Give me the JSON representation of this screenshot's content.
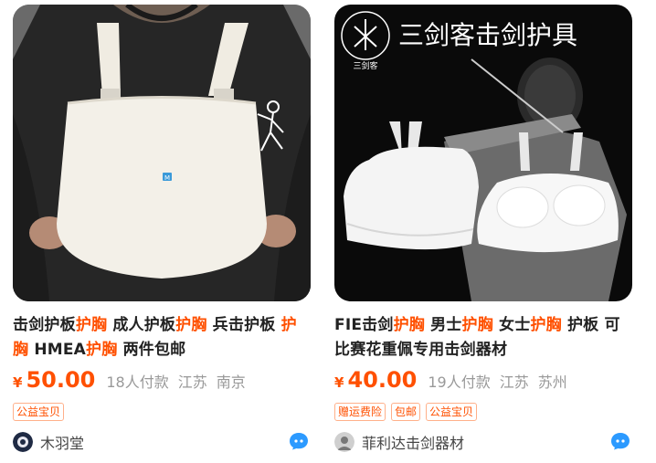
{
  "products": [
    {
      "title_parts": [
        {
          "text": "击剑护板",
          "hl": false
        },
        {
          "text": "护胸",
          "hl": true
        },
        {
          "text": " 成人护板",
          "hl": false
        },
        {
          "text": "护胸",
          "hl": true
        },
        {
          "text": " 兵击护板 ",
          "hl": false
        },
        {
          "text": "护胸",
          "hl": true
        },
        {
          "text": " HMEA",
          "hl": false
        },
        {
          "text": "护胸",
          "hl": true
        },
        {
          "text": " 两件包邮",
          "hl": false
        }
      ],
      "currency": "¥",
      "price": "50.00",
      "sold": "18人付款",
      "province": "江苏",
      "city": "南京",
      "tags": [
        "公益宝贝"
      ],
      "shop_name": "木羽堂",
      "image_tag": "M"
    },
    {
      "title_parts": [
        {
          "text": "FIE击剑",
          "hl": false
        },
        {
          "text": "护胸",
          "hl": true
        },
        {
          "text": " 男士",
          "hl": false
        },
        {
          "text": "护胸",
          "hl": true
        },
        {
          "text": " 女士",
          "hl": false
        },
        {
          "text": "护胸",
          "hl": true
        },
        {
          "text": " 护板 可比赛花重佩专用击剑器材",
          "hl": false
        }
      ],
      "currency": "¥",
      "price": "40.00",
      "sold": "19人付款",
      "province": "江苏",
      "city": "苏州",
      "tags": [
        "赠运费险",
        "包邮",
        "公益宝贝"
      ],
      "shop_name": "菲利达击剑器材",
      "banner_text": "三剑客击剑护具",
      "logo_text": "三剑客"
    }
  ],
  "colors": {
    "accent": "#ff5000",
    "muted": "#999999"
  },
  "icons": {
    "chat": "wangwang-chat-icon"
  }
}
